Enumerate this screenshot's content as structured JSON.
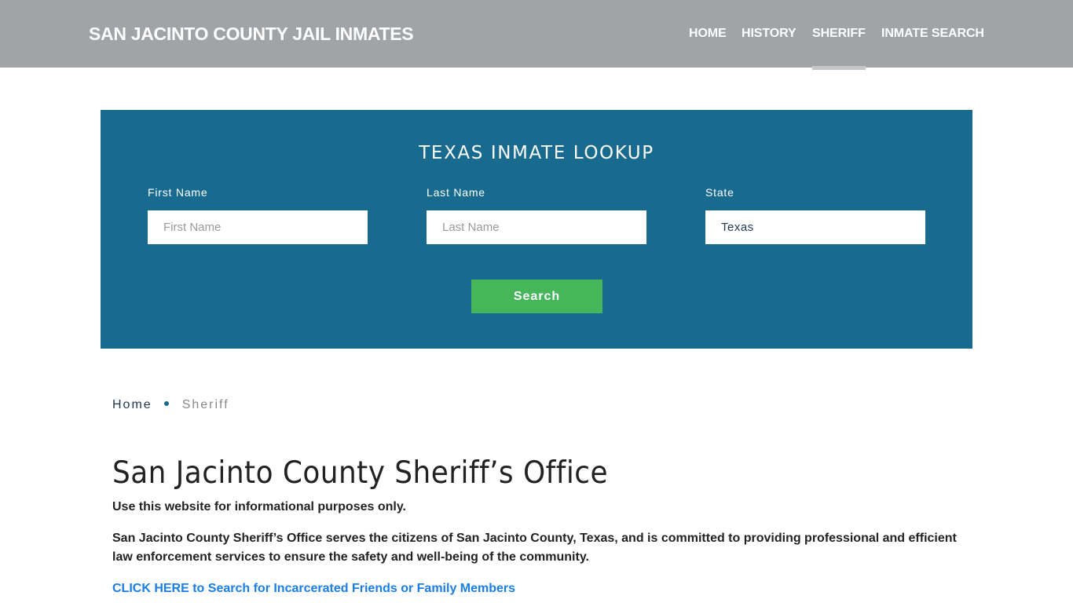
{
  "header": {
    "site_title": "SAN JACINTO COUNTY JAIL INMATES",
    "nav": [
      {
        "label": "HOME",
        "active": false
      },
      {
        "label": "HISTORY",
        "active": false
      },
      {
        "label": "SHERIFF",
        "active": true
      },
      {
        "label": "INMATE SEARCH",
        "active": false
      }
    ]
  },
  "lookup": {
    "title": "TEXAS INMATE LOOKUP",
    "first_name": {
      "label": "First Name",
      "placeholder": "First Name",
      "value": ""
    },
    "last_name": {
      "label": "Last Name",
      "placeholder": "Last Name",
      "value": ""
    },
    "state": {
      "label": "State",
      "selected": "Texas"
    },
    "search_label": "Search"
  },
  "breadcrumb": {
    "home": "Home",
    "current": "Sheriff"
  },
  "content": {
    "title": "San Jacinto County Sheriff’s Office",
    "disclaimer": "Use this website for informational purposes only.",
    "description": "San Jacinto County Sheriff’s Office serves the citizens of San Jacinto County, Texas, and is committed to providing professional and efficient law enforcement services to ensure the safety and well-being of the community.",
    "cta_link": "CLICK HERE to Search for Incarcerated Friends or Family Members"
  },
  "colors": {
    "header_bg": "#a0a4a7",
    "lookup_bg": "#186b8f",
    "search_button": "#45b75a",
    "link": "#1a7ee6"
  }
}
